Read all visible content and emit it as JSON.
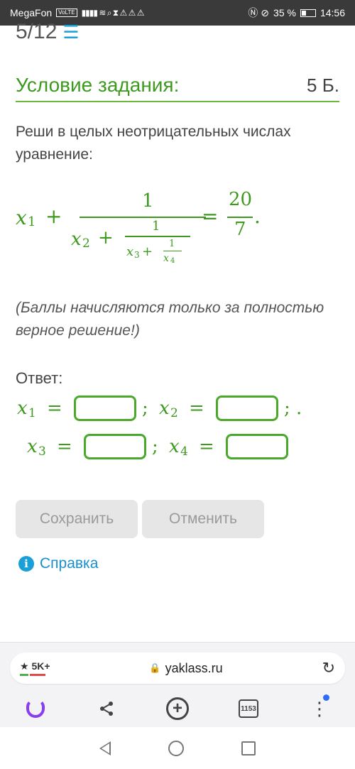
{
  "status_bar": {
    "carrier": "MegaFon",
    "network_badge": "VoLTE",
    "left_icons": "▮▮▮▮ ≋ ⌕ ⧗ ⚠ ⚠ ⚠",
    "right_icons": "Ⓝ ⊘",
    "battery": "35 %",
    "time": "14:56"
  },
  "progress": {
    "label": "5/12",
    "icon": "list-icon"
  },
  "task": {
    "header": "Условие задания:",
    "points": "5 Б.",
    "text": "Реши в целых неотрицательных числах уравнение:",
    "note": "(Баллы начисляются только за полностью верное решение!)",
    "formula": {
      "lhs": "x",
      "lhs_sub": "1",
      "plus": "+",
      "num1": "1",
      "den_x": "x",
      "den_sub": "2",
      "den_plus": "+",
      "num2": "1",
      "den2_x": "x",
      "den2_sub": "3",
      "den2_plus": "+",
      "num3": "1",
      "den3_x": "x",
      "den3_sub": "4",
      "equals": "=",
      "rhs_num": "20",
      "rhs_den": "7",
      "dot": "."
    }
  },
  "answer": {
    "label": "Ответ:",
    "vars": [
      {
        "x": "x",
        "sub": "1",
        "eq": "=",
        "sep": ";"
      },
      {
        "x": "x",
        "sub": "2",
        "eq": "=",
        "sep": "; ."
      },
      {
        "x": "x",
        "sub": "3",
        "eq": "=",
        "sep": ";"
      },
      {
        "x": "x",
        "sub": "4",
        "eq": "=",
        "sep": ""
      }
    ],
    "fields": [
      "",
      "",
      "",
      ""
    ]
  },
  "buttons": {
    "save": "Сохранить",
    "cancel": "Отменить"
  },
  "help": {
    "icon": "info-icon",
    "label": "Справка"
  },
  "browser": {
    "rating": "★ 5K+",
    "url": "yaklass.ru",
    "lock_icon": "lock-icon",
    "reload_icon": "reload-icon",
    "tabs_count": "1153",
    "accent_color": "#8a3df0"
  }
}
